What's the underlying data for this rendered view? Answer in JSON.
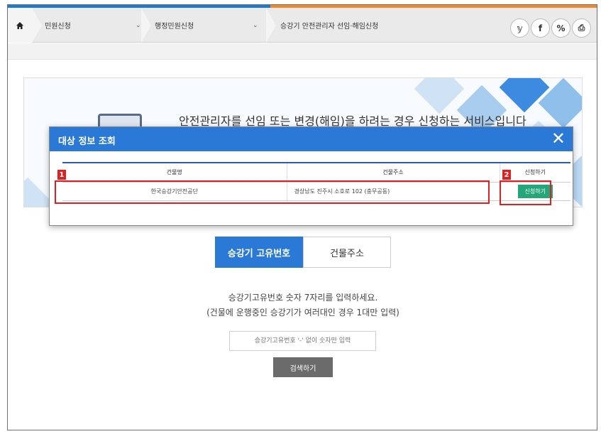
{
  "breadcrumb": {
    "home_icon": "home-icon",
    "item1": "민원신청",
    "item2": "행정민원신청",
    "item3": "승강기 안전관리자 선임·해임신청"
  },
  "share": {
    "twitter": "𝕪",
    "facebook": "f",
    "link": "%",
    "print": "⎙"
  },
  "banner": {
    "text": "안전관리자를 선임 또는 변경(해임)을 하려는 경우 신청하는 서비스입니다"
  },
  "tabs": [
    {
      "label": "승강기 고유번호",
      "active": true
    },
    {
      "label": "건물주소",
      "active": false
    }
  ],
  "guide": {
    "line1": "승강기고유번호 숫자 7자리를 입력하세요.",
    "line2": "(건물에 운행중인 승강기가 여러대인 경우 1대만 입력)"
  },
  "search": {
    "placeholder": "승강기고유번호 '-' 없이 숫자만 입력",
    "button": "검색하기"
  },
  "modal": {
    "title": "대상 정보 조회",
    "close": "✕",
    "columns": [
      "건물명",
      "건물주소",
      "신청하기"
    ],
    "rows": [
      {
        "name": "한국승강기안전공단",
        "address": "경상남도 진주시 소호로 102 (충무공동)",
        "action": "신청하기"
      }
    ]
  },
  "annotations": {
    "marker1": "1",
    "marker2": "2"
  },
  "colors": {
    "primary": "#2a79d6",
    "apply_green": "#24a57a",
    "highlight_red": "#e02020",
    "accent_orange": "#f08a2c"
  }
}
